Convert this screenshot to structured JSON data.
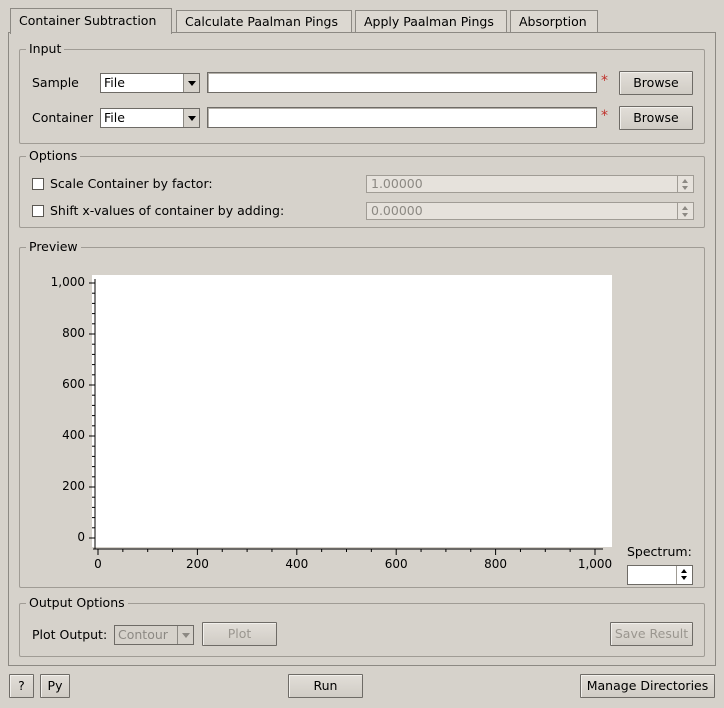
{
  "tabs": [
    {
      "label": "Container Subtraction",
      "active": true
    },
    {
      "label": "Calculate Paalman Pings",
      "active": false
    },
    {
      "label": "Apply Paalman Pings",
      "active": false
    },
    {
      "label": "Absorption",
      "active": false
    }
  ],
  "input": {
    "title": "Input",
    "sample": {
      "label": "Sample",
      "source": "File",
      "value": "",
      "required_mark": "*",
      "browse_label": "Browse"
    },
    "container": {
      "label": "Container",
      "source": "File",
      "value": "",
      "required_mark": "*",
      "browse_label": "Browse"
    }
  },
  "options": {
    "title": "Options",
    "scale": {
      "label": "Scale Container by factor:",
      "checked": false,
      "value": "1.00000"
    },
    "shift": {
      "label": "Shift x-values of container by adding:",
      "checked": false,
      "value": "0.00000"
    }
  },
  "preview": {
    "title": "Preview",
    "spectrum_label": "Spectrum:",
    "spectrum_value": ""
  },
  "chart_data": {
    "type": "line",
    "series": [],
    "xlim": [
      0,
      1000
    ],
    "ylim": [
      0,
      1000
    ],
    "x_ticks": [
      "0",
      "200",
      "400",
      "600",
      "800",
      "1,000"
    ],
    "y_ticks": [
      "0",
      "200",
      "400",
      "600",
      "800",
      "1,000"
    ],
    "xlabel": "",
    "ylabel": "",
    "grid": false
  },
  "output": {
    "title": "Output Options",
    "plot_output_label": "Plot Output:",
    "plot_output_value": "Contour",
    "plot_label": "Plot",
    "save_label": "Save Result"
  },
  "footer": {
    "help_label": "?",
    "python_label": "Py",
    "run_label": "Run",
    "manage_dirs_label": "Manage Directories"
  }
}
